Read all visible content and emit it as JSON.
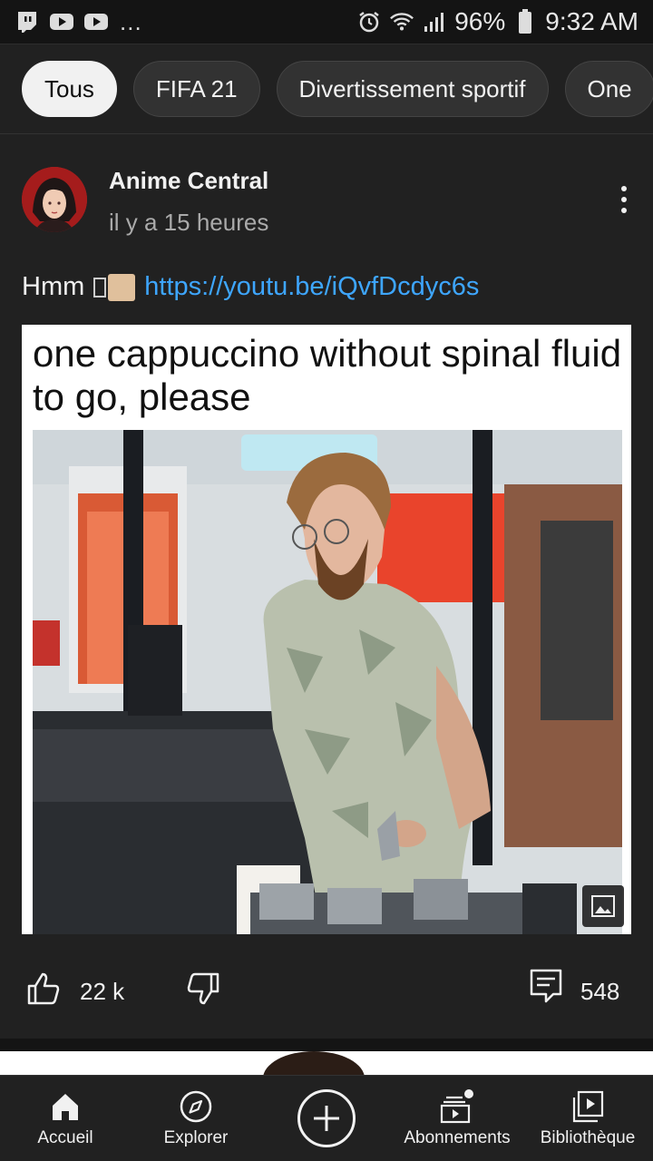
{
  "status_bar": {
    "left_icons": [
      "twitch-icon",
      "youtube-icon",
      "youtube-icon"
    ],
    "more": "...",
    "battery": "96%",
    "time": "9:32 AM"
  },
  "chips": [
    "Tous",
    "FIFA 21",
    "Divertissement sportif",
    "One"
  ],
  "post": {
    "channel": "Anime Central",
    "time": "il y a 15 heures",
    "text": "Hmm",
    "link": "https://youtu.be/iQvfDcdyc6s",
    "meme_caption": "one cappuccino without spinal fluid to go, please",
    "likes": "22 k",
    "comments": "548"
  },
  "nav": {
    "home": "Accueil",
    "explore": "Explorer",
    "subscriptions": "Abonnements",
    "library": "Bibliothèque"
  },
  "colors": {
    "background": "#212121",
    "link": "#3ea6ff",
    "chip_active": "#f1f1f1"
  }
}
